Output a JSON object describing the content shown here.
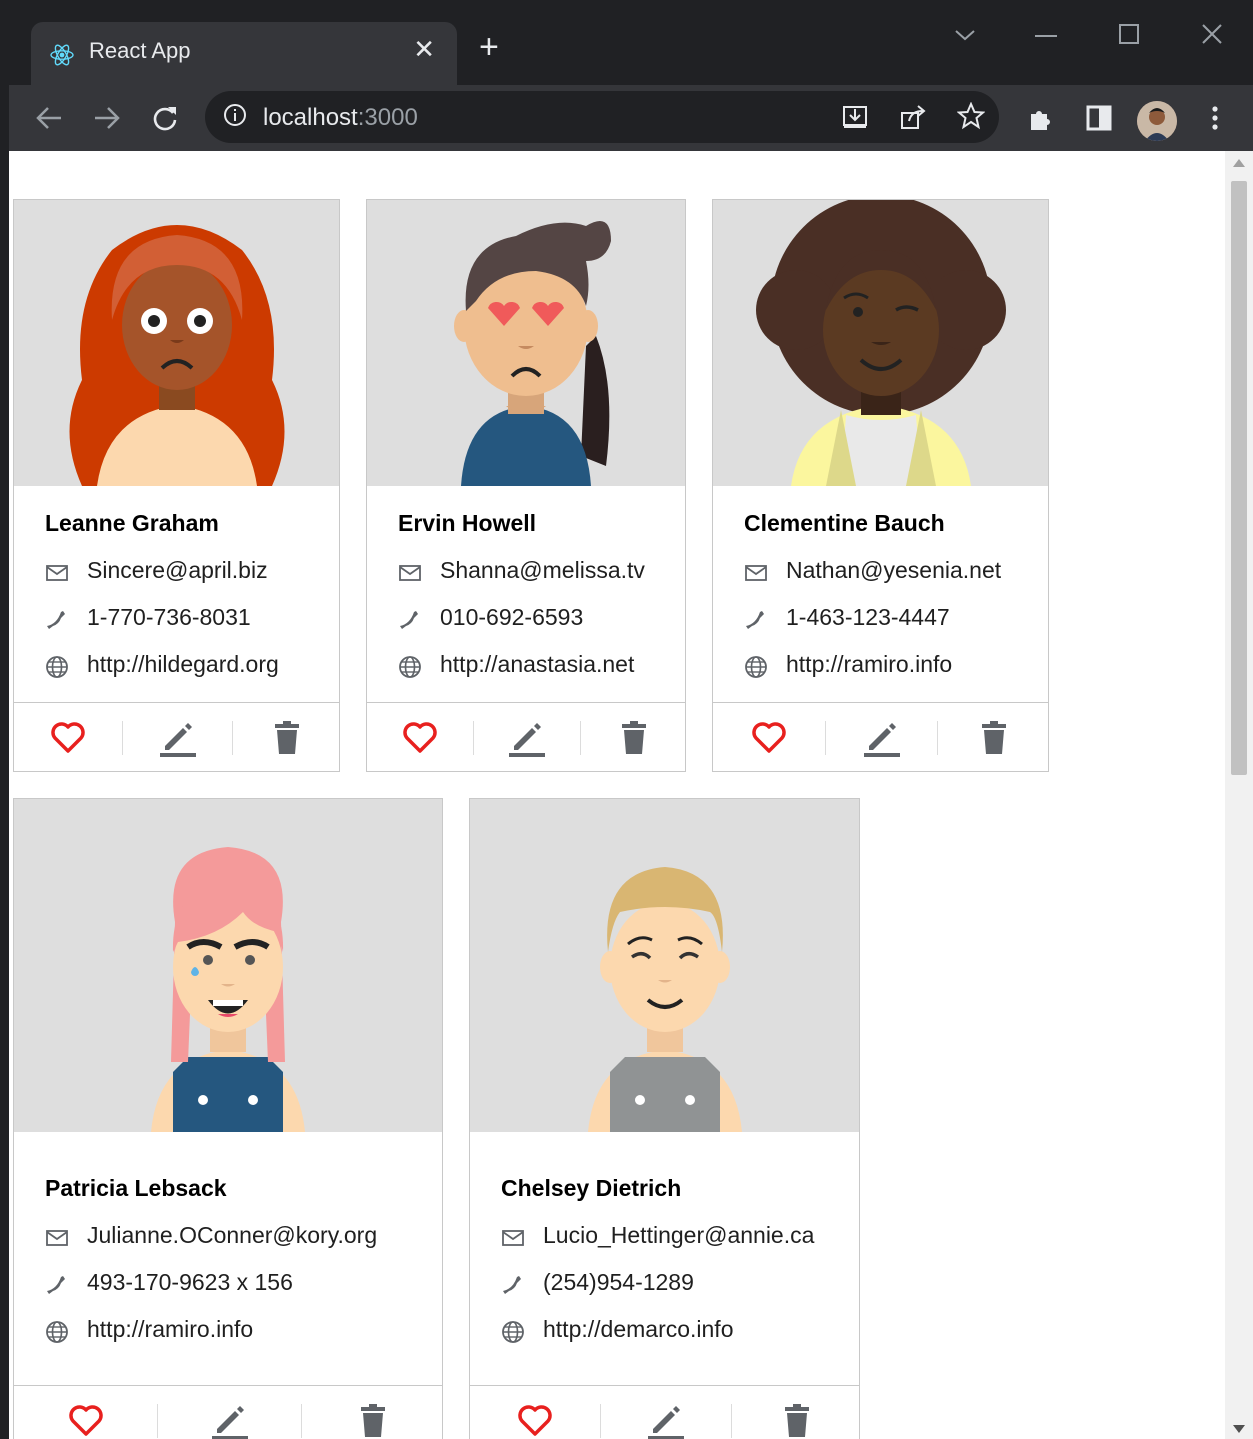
{
  "browser": {
    "tab_title": "React App",
    "tab_close": "✕",
    "new_tab": "+",
    "url_host": "localhost",
    "url_port": ":3000"
  },
  "colors": {
    "heart": "#e8201e",
    "icon_gray": "#5f6368",
    "card_border": "#c8c8c8",
    "avatar_bg": "#dedede"
  },
  "cards": [
    {
      "name": "Leanne Graham",
      "email": "Sincere@april.biz",
      "phone": "1-770-736-8031",
      "website": "http://hildegard.org"
    },
    {
      "name": "Ervin Howell",
      "email": "Shanna@melissa.tv",
      "phone": "010-692-6593",
      "website": "http://anastasia.net"
    },
    {
      "name": "Clementine Bauch",
      "email": "Nathan@yesenia.net",
      "phone": "1-463-123-4447",
      "website": "http://ramiro.info"
    },
    {
      "name": "Patricia Lebsack",
      "email": "Julianne.OConner@kory.org",
      "phone": "493-170-9623 x 156",
      "website": "http://ramiro.info"
    },
    {
      "name": "Chelsey Dietrich",
      "email": "Lucio_Hettinger@annie.ca",
      "phone": "(254)954-1289",
      "website": "http://demarco.info"
    }
  ]
}
